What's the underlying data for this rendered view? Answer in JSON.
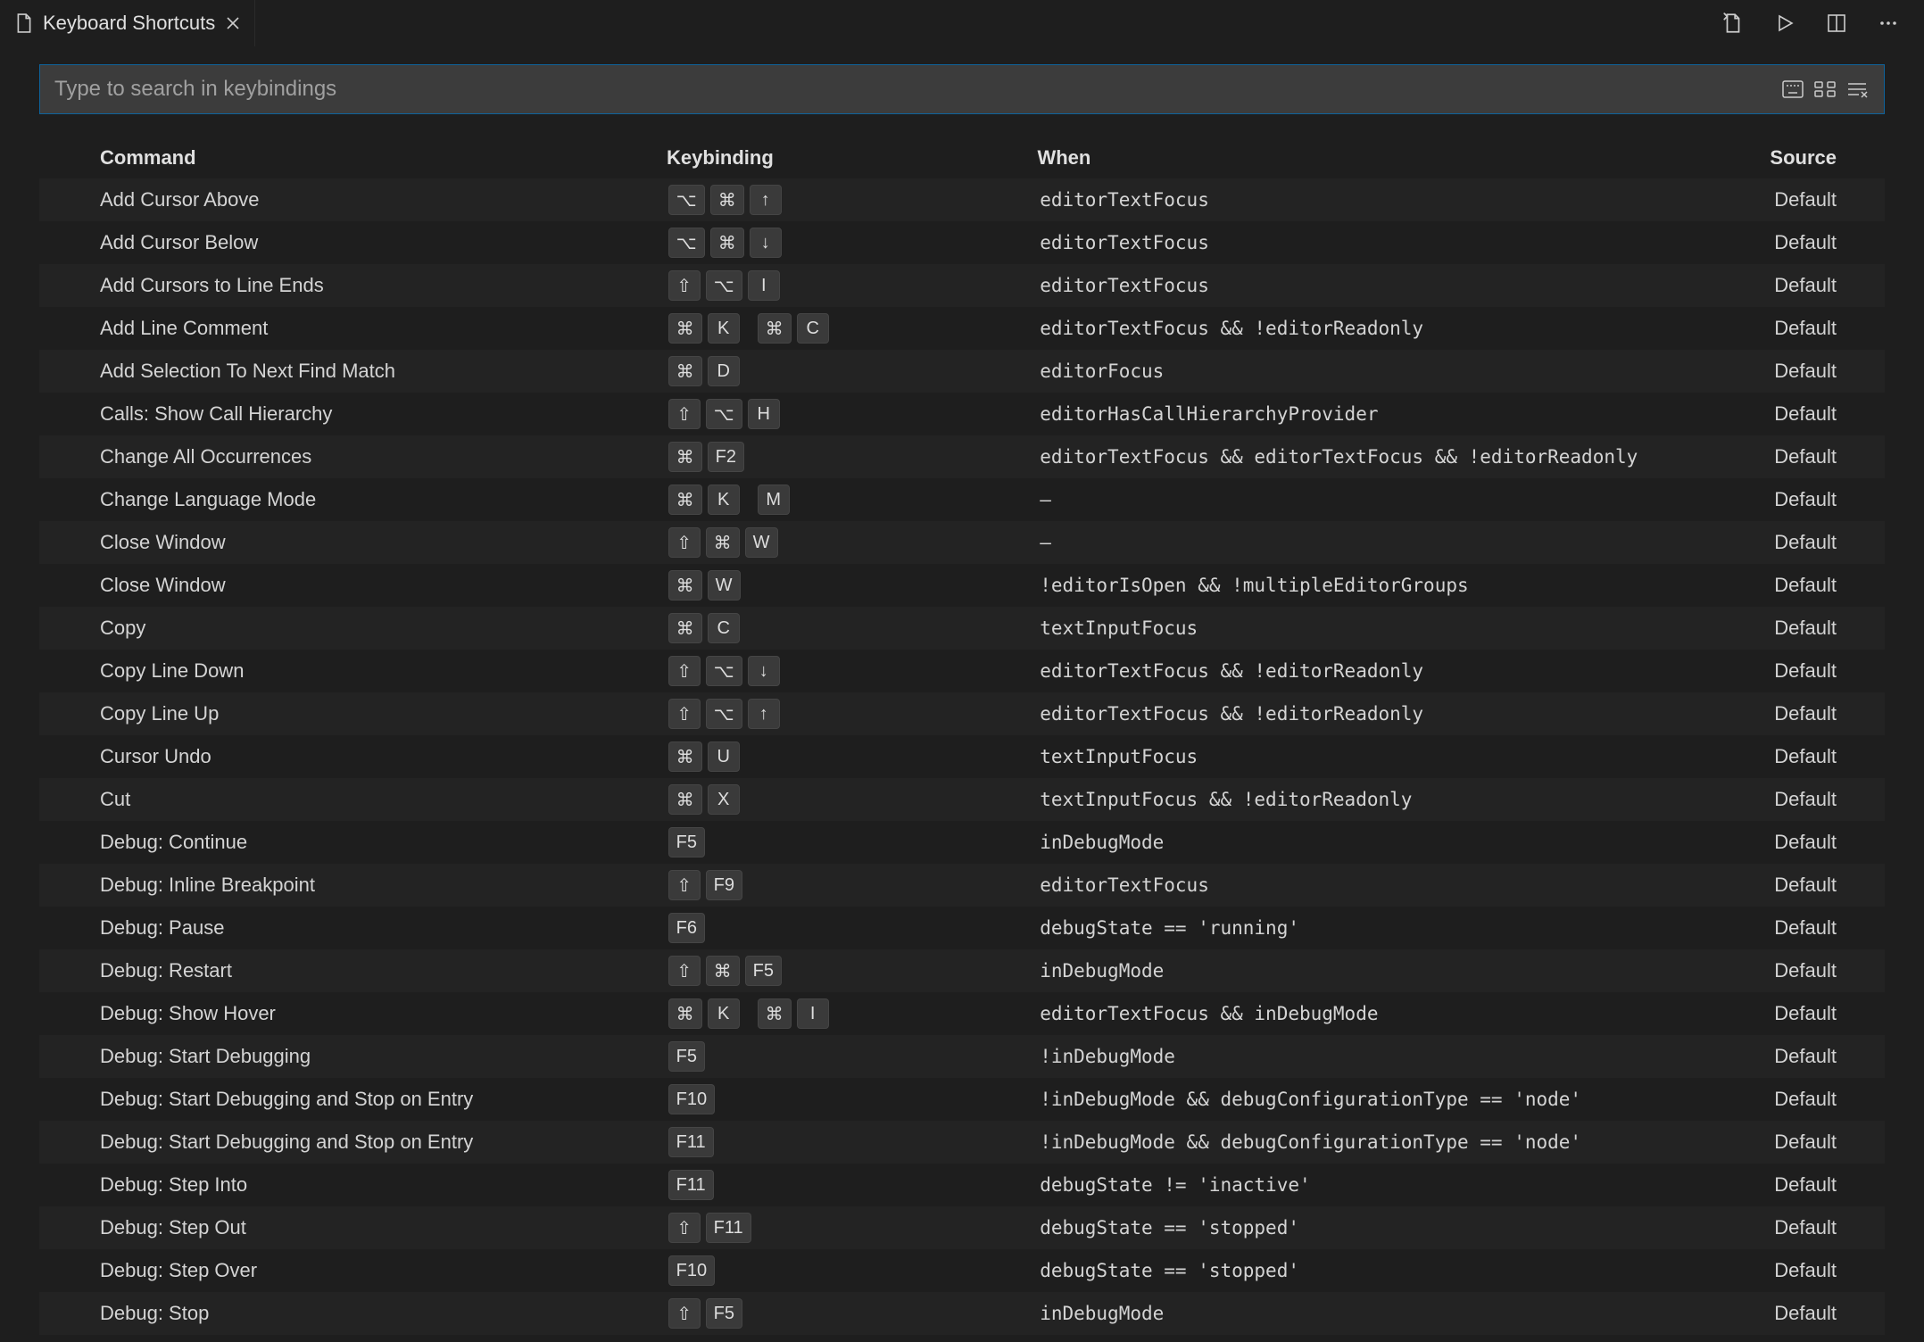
{
  "tab": {
    "title": "Keyboard Shortcuts"
  },
  "search": {
    "placeholder": "Type to search in keybindings"
  },
  "columns": {
    "command": "Command",
    "keybinding": "Keybinding",
    "when": "When",
    "source": "Source"
  },
  "rows": [
    {
      "command": "Add Cursor Above",
      "keys": [
        [
          "⌥",
          "⌘",
          "↑"
        ]
      ],
      "when": "editorTextFocus",
      "source": "Default"
    },
    {
      "command": "Add Cursor Below",
      "keys": [
        [
          "⌥",
          "⌘",
          "↓"
        ]
      ],
      "when": "editorTextFocus",
      "source": "Default"
    },
    {
      "command": "Add Cursors to Line Ends",
      "keys": [
        [
          "⇧",
          "⌥",
          "I"
        ]
      ],
      "when": "editorTextFocus",
      "source": "Default"
    },
    {
      "command": "Add Line Comment",
      "keys": [
        [
          "⌘",
          "K"
        ],
        [
          "⌘",
          "C"
        ]
      ],
      "when": "editorTextFocus && !editorReadonly",
      "source": "Default"
    },
    {
      "command": "Add Selection To Next Find Match",
      "keys": [
        [
          "⌘",
          "D"
        ]
      ],
      "when": "editorFocus",
      "source": "Default"
    },
    {
      "command": "Calls: Show Call Hierarchy",
      "keys": [
        [
          "⇧",
          "⌥",
          "H"
        ]
      ],
      "when": "editorHasCallHierarchyProvider",
      "source": "Default"
    },
    {
      "command": "Change All Occurrences",
      "keys": [
        [
          "⌘",
          "F2"
        ]
      ],
      "when": "editorTextFocus && editorTextFocus && !editorReadonly",
      "source": "Default"
    },
    {
      "command": "Change Language Mode",
      "keys": [
        [
          "⌘",
          "K"
        ],
        [
          "M"
        ]
      ],
      "when": "—",
      "source": "Default"
    },
    {
      "command": "Close Window",
      "keys": [
        [
          "⇧",
          "⌘",
          "W"
        ]
      ],
      "when": "—",
      "source": "Default"
    },
    {
      "command": "Close Window",
      "keys": [
        [
          "⌘",
          "W"
        ]
      ],
      "when": "!editorIsOpen && !multipleEditorGroups",
      "source": "Default"
    },
    {
      "command": "Copy",
      "keys": [
        [
          "⌘",
          "C"
        ]
      ],
      "when": "textInputFocus",
      "source": "Default"
    },
    {
      "command": "Copy Line Down",
      "keys": [
        [
          "⇧",
          "⌥",
          "↓"
        ]
      ],
      "when": "editorTextFocus && !editorReadonly",
      "source": "Default"
    },
    {
      "command": "Copy Line Up",
      "keys": [
        [
          "⇧",
          "⌥",
          "↑"
        ]
      ],
      "when": "editorTextFocus && !editorReadonly",
      "source": "Default"
    },
    {
      "command": "Cursor Undo",
      "keys": [
        [
          "⌘",
          "U"
        ]
      ],
      "when": "textInputFocus",
      "source": "Default"
    },
    {
      "command": "Cut",
      "keys": [
        [
          "⌘",
          "X"
        ]
      ],
      "when": "textInputFocus && !editorReadonly",
      "source": "Default"
    },
    {
      "command": "Debug: Continue",
      "keys": [
        [
          "F5"
        ]
      ],
      "when": "inDebugMode",
      "source": "Default"
    },
    {
      "command": "Debug: Inline Breakpoint",
      "keys": [
        [
          "⇧",
          "F9"
        ]
      ],
      "when": "editorTextFocus",
      "source": "Default"
    },
    {
      "command": "Debug: Pause",
      "keys": [
        [
          "F6"
        ]
      ],
      "when": "debugState == 'running'",
      "source": "Default"
    },
    {
      "command": "Debug: Restart",
      "keys": [
        [
          "⇧",
          "⌘",
          "F5"
        ]
      ],
      "when": "inDebugMode",
      "source": "Default"
    },
    {
      "command": "Debug: Show Hover",
      "keys": [
        [
          "⌘",
          "K"
        ],
        [
          "⌘",
          "I"
        ]
      ],
      "when": "editorTextFocus && inDebugMode",
      "source": "Default"
    },
    {
      "command": "Debug: Start Debugging",
      "keys": [
        [
          "F5"
        ]
      ],
      "when": "!inDebugMode",
      "source": "Default"
    },
    {
      "command": "Debug: Start Debugging and Stop on Entry",
      "keys": [
        [
          "F10"
        ]
      ],
      "when": "!inDebugMode && debugConfigurationType == 'node'",
      "source": "Default"
    },
    {
      "command": "Debug: Start Debugging and Stop on Entry",
      "keys": [
        [
          "F11"
        ]
      ],
      "when": "!inDebugMode && debugConfigurationType == 'node'",
      "source": "Default"
    },
    {
      "command": "Debug: Step Into",
      "keys": [
        [
          "F11"
        ]
      ],
      "when": "debugState != 'inactive'",
      "source": "Default"
    },
    {
      "command": "Debug: Step Out",
      "keys": [
        [
          "⇧",
          "F11"
        ]
      ],
      "when": "debugState == 'stopped'",
      "source": "Default"
    },
    {
      "command": "Debug: Step Over",
      "keys": [
        [
          "F10"
        ]
      ],
      "when": "debugState == 'stopped'",
      "source": "Default"
    },
    {
      "command": "Debug: Stop",
      "keys": [
        [
          "⇧",
          "F5"
        ]
      ],
      "when": "inDebugMode",
      "source": "Default"
    }
  ]
}
